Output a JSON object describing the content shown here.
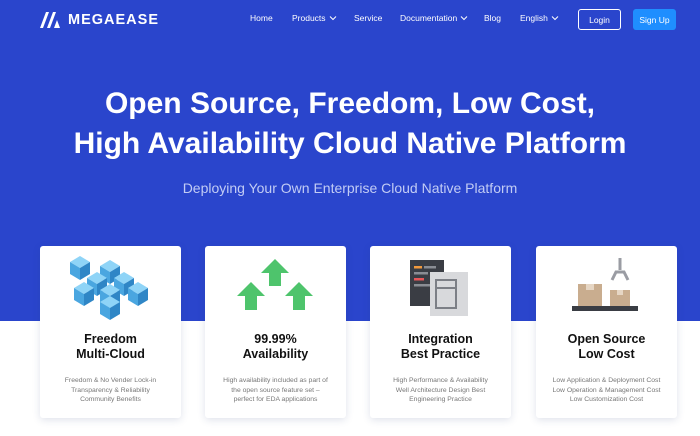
{
  "brand": {
    "name": "MEGAEASE"
  },
  "nav": {
    "items": [
      {
        "label": "Home",
        "has_dropdown": false
      },
      {
        "label": "Products",
        "has_dropdown": true
      },
      {
        "label": "Service",
        "has_dropdown": false
      },
      {
        "label": "Documentation",
        "has_dropdown": true
      },
      {
        "label": "Blog",
        "has_dropdown": false
      },
      {
        "label": "English",
        "has_dropdown": true
      }
    ],
    "login_label": "Login",
    "signup_label": "Sign Up"
  },
  "hero": {
    "headline_line1": "Open Source, Freedom, Low Cost,",
    "headline_line2": "High Availability Cloud Native Platform",
    "subtitle": "Deploying Your Own Enterprise Cloud Native Platform"
  },
  "cards": [
    {
      "icon": "cubes-icon",
      "title_line1": "Freedom",
      "title_line2": "Multi-Cloud",
      "desc": [
        "Freedom & No Vender Lock-in",
        "Transparency & Reliability",
        "Community Benefits"
      ]
    },
    {
      "icon": "arrows-up-icon",
      "title_line1": "99.99%",
      "title_line2": "Availability",
      "desc": [
        "High availability included as part of",
        "the open source feature set –",
        "perfect for EDA applications"
      ]
    },
    {
      "icon": "documents-icon",
      "title_line1": "Integration",
      "title_line2": "Best Practice",
      "desc": [
        "High Performance & Availability",
        "Well Architecture Design Best",
        "Engineering Practice"
      ]
    },
    {
      "icon": "crane-boxes-icon",
      "title_line1": "Open Source",
      "title_line2": "Low Cost",
      "desc": [
        "Low Application & Deployment Cost",
        "Low Operation & Management Cost",
        "Low Customization Cost"
      ]
    }
  ],
  "colors": {
    "hero_bg": "#2a45cc",
    "signup_bg": "#1f8eff",
    "cube": "#5cb8ec",
    "arrow": "#4ec46c",
    "box": "#c9ad8f"
  }
}
